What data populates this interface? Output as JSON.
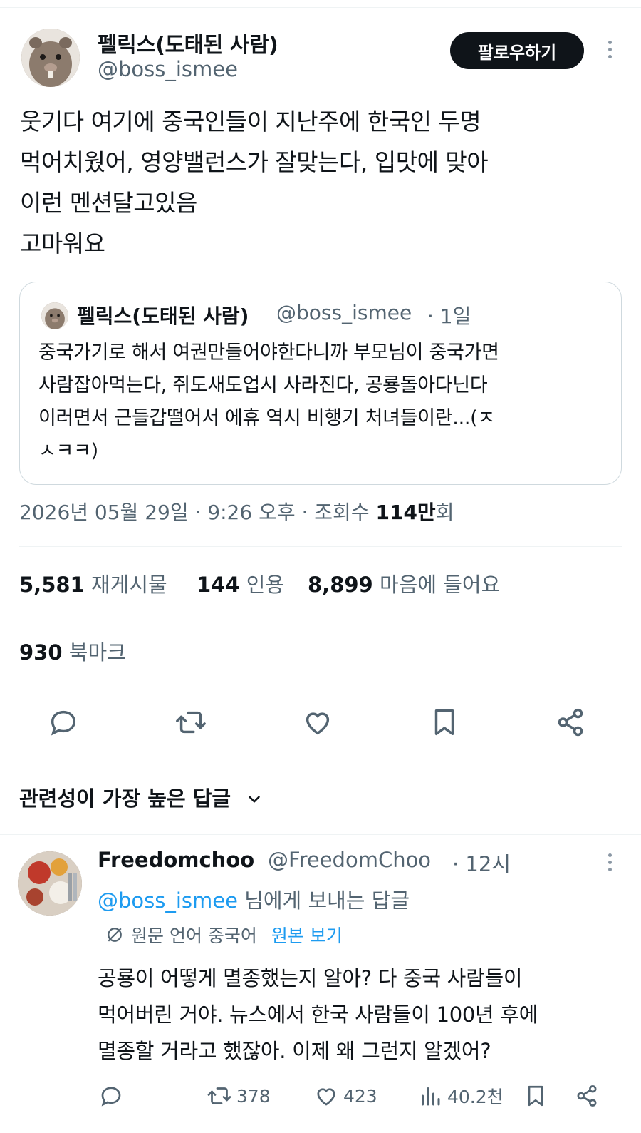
{
  "tweet": {
    "author_name": "펠릭스(도태된 사람)",
    "author_handle": "@boss_ismee",
    "follow_label": "팔로우하기",
    "body_lines": [
      "웃기다 여기에 중국인들이 지난주에 한국인 두명",
      "먹어치웠어, 영양밸런스가 잘맞는다, 입맛에 맞아",
      "이런 멘션달고있음",
      "고마워요"
    ],
    "quote": {
      "author_name": "펠릭스(도태된 사람)",
      "author_handle": "@boss_ismee",
      "time": "· 1일",
      "body_lines": [
        "중국가기로 해서 여권만들어야한다니까 부모님이 중국가면",
        "사람잡아먹는다, 쥐도새도업시 사라진다, 공룡돌아다닌다",
        "이러면서 근들갑떨어서 에휴 역시 비행기 처녀들이란...(ㅈ",
        "ㅅㅋㅋ)"
      ]
    },
    "timestamp": "2026년 05월 29일 · 9:26 오후 · 조회수 ",
    "views_value": "114만",
    "views_suffix": "회",
    "stats": {
      "reposts_count": "5,581",
      "reposts_label": "재게시물",
      "quotes_count": "144",
      "quotes_label": "인용",
      "likes_count": "8,899",
      "likes_label": "마음에 들어요",
      "bookmarks_count": "930",
      "bookmarks_label": "북마크"
    },
    "action_icons": [
      "reply-icon",
      "retweet-icon",
      "heart-icon",
      "bookmark-icon",
      "share-icon"
    ]
  },
  "replies_section": {
    "title": "관련성이 가장 높은 답글"
  },
  "reply": {
    "author_name": "Freedomchoo",
    "author_handle": "@FreedomChoo",
    "time": "· 12시",
    "replying_to_handle": "@boss_ismee",
    "replying_to_suffix": " 님에게 보내는 답글",
    "translate_info": "원문 언어 중국어",
    "translate_link": "원본 보기",
    "body_lines": [
      "공룡이 어떻게 멸종했는지 알아? 다 중국 사람들이",
      "먹어버린 거야. 뉴스에서 한국 사람들이 100년 후에",
      "멸종할 거라고 했잖아. 이제 왜 그런지 알겠어?"
    ],
    "retweets": "378",
    "likes": "423",
    "views": "40.2천"
  },
  "colors": {
    "text": "#0f1419",
    "secondary": "#536471",
    "link": "#1d9bf0",
    "border": "#cfd9de",
    "button": "#0f1419"
  }
}
